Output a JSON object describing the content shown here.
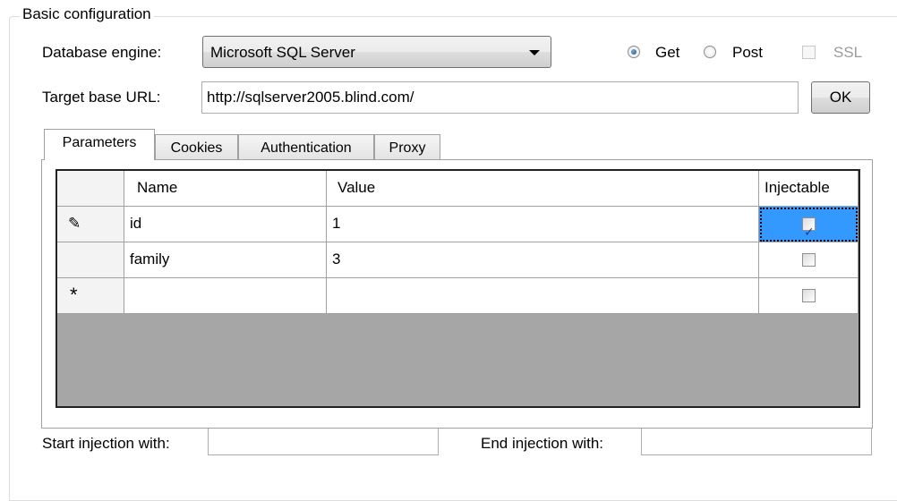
{
  "group": {
    "title": "Basic configuration"
  },
  "engine": {
    "label": "Database engine:",
    "selected": "Microsoft SQL Server"
  },
  "method": {
    "get_label": "Get",
    "post_label": "Post",
    "ssl_label": "SSL",
    "selected": "Get"
  },
  "target": {
    "label": "Target base URL:",
    "value": "http://sqlserver2005.blind.com/",
    "ok_label": "OK"
  },
  "tabs": [
    {
      "label": "Parameters",
      "active": true
    },
    {
      "label": "Cookies"
    },
    {
      "label": "Authentication"
    },
    {
      "label": "Proxy"
    }
  ],
  "grid": {
    "columns": [
      "Name",
      "Value",
      "Injectable"
    ],
    "rows": [
      {
        "marker": "✎",
        "name": "id",
        "value": "1",
        "injectable": true
      },
      {
        "marker": "",
        "name": "family",
        "value": "3",
        "injectable": false
      },
      {
        "marker": "*",
        "name": "",
        "value": "",
        "injectable": false
      }
    ]
  },
  "injection": {
    "start_label": "Start injection with:",
    "start_value": "",
    "end_label": "End injection with:",
    "end_value": ""
  }
}
